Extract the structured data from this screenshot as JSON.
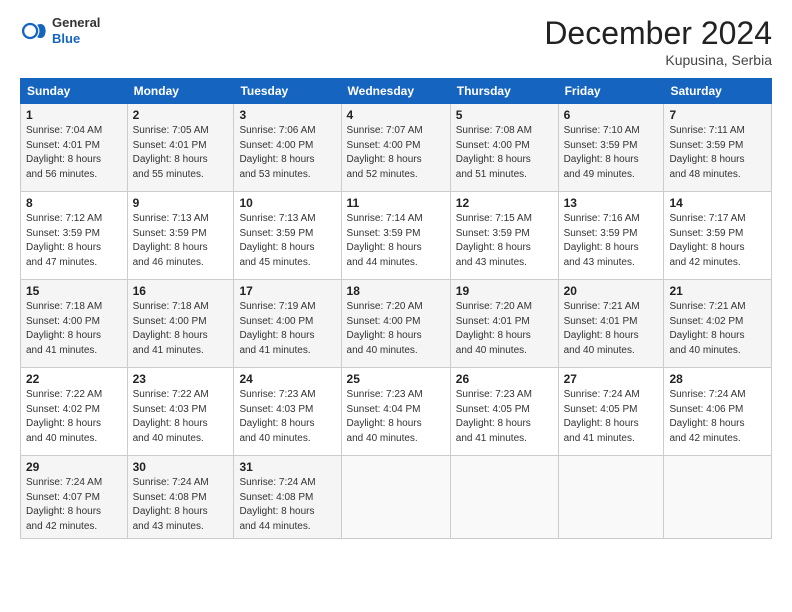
{
  "header": {
    "logo": {
      "general": "General",
      "blue": "Blue"
    },
    "title": "December 2024",
    "location": "Kupusina, Serbia"
  },
  "weekdays": [
    "Sunday",
    "Monday",
    "Tuesday",
    "Wednesday",
    "Thursday",
    "Friday",
    "Saturday"
  ],
  "weeks": [
    [
      {
        "day": "1",
        "sunrise": "7:04 AM",
        "sunset": "4:01 PM",
        "daylight": "8 hours and 56 minutes."
      },
      {
        "day": "2",
        "sunrise": "7:05 AM",
        "sunset": "4:01 PM",
        "daylight": "8 hours and 55 minutes."
      },
      {
        "day": "3",
        "sunrise": "7:06 AM",
        "sunset": "4:00 PM",
        "daylight": "8 hours and 53 minutes."
      },
      {
        "day": "4",
        "sunrise": "7:07 AM",
        "sunset": "4:00 PM",
        "daylight": "8 hours and 52 minutes."
      },
      {
        "day": "5",
        "sunrise": "7:08 AM",
        "sunset": "4:00 PM",
        "daylight": "8 hours and 51 minutes."
      },
      {
        "day": "6",
        "sunrise": "7:10 AM",
        "sunset": "3:59 PM",
        "daylight": "8 hours and 49 minutes."
      },
      {
        "day": "7",
        "sunrise": "7:11 AM",
        "sunset": "3:59 PM",
        "daylight": "8 hours and 48 minutes."
      }
    ],
    [
      {
        "day": "8",
        "sunrise": "7:12 AM",
        "sunset": "3:59 PM",
        "daylight": "8 hours and 47 minutes."
      },
      {
        "day": "9",
        "sunrise": "7:13 AM",
        "sunset": "3:59 PM",
        "daylight": "8 hours and 46 minutes."
      },
      {
        "day": "10",
        "sunrise": "7:13 AM",
        "sunset": "3:59 PM",
        "daylight": "8 hours and 45 minutes."
      },
      {
        "day": "11",
        "sunrise": "7:14 AM",
        "sunset": "3:59 PM",
        "daylight": "8 hours and 44 minutes."
      },
      {
        "day": "12",
        "sunrise": "7:15 AM",
        "sunset": "3:59 PM",
        "daylight": "8 hours and 43 minutes."
      },
      {
        "day": "13",
        "sunrise": "7:16 AM",
        "sunset": "3:59 PM",
        "daylight": "8 hours and 43 minutes."
      },
      {
        "day": "14",
        "sunrise": "7:17 AM",
        "sunset": "3:59 PM",
        "daylight": "8 hours and 42 minutes."
      }
    ],
    [
      {
        "day": "15",
        "sunrise": "7:18 AM",
        "sunset": "4:00 PM",
        "daylight": "8 hours and 41 minutes."
      },
      {
        "day": "16",
        "sunrise": "7:18 AM",
        "sunset": "4:00 PM",
        "daylight": "8 hours and 41 minutes."
      },
      {
        "day": "17",
        "sunrise": "7:19 AM",
        "sunset": "4:00 PM",
        "daylight": "8 hours and 41 minutes."
      },
      {
        "day": "18",
        "sunrise": "7:20 AM",
        "sunset": "4:00 PM",
        "daylight": "8 hours and 40 minutes."
      },
      {
        "day": "19",
        "sunrise": "7:20 AM",
        "sunset": "4:01 PM",
        "daylight": "8 hours and 40 minutes."
      },
      {
        "day": "20",
        "sunrise": "7:21 AM",
        "sunset": "4:01 PM",
        "daylight": "8 hours and 40 minutes."
      },
      {
        "day": "21",
        "sunrise": "7:21 AM",
        "sunset": "4:02 PM",
        "daylight": "8 hours and 40 minutes."
      }
    ],
    [
      {
        "day": "22",
        "sunrise": "7:22 AM",
        "sunset": "4:02 PM",
        "daylight": "8 hours and 40 minutes."
      },
      {
        "day": "23",
        "sunrise": "7:22 AM",
        "sunset": "4:03 PM",
        "daylight": "8 hours and 40 minutes."
      },
      {
        "day": "24",
        "sunrise": "7:23 AM",
        "sunset": "4:03 PM",
        "daylight": "8 hours and 40 minutes."
      },
      {
        "day": "25",
        "sunrise": "7:23 AM",
        "sunset": "4:04 PM",
        "daylight": "8 hours and 40 minutes."
      },
      {
        "day": "26",
        "sunrise": "7:23 AM",
        "sunset": "4:05 PM",
        "daylight": "8 hours and 41 minutes."
      },
      {
        "day": "27",
        "sunrise": "7:24 AM",
        "sunset": "4:05 PM",
        "daylight": "8 hours and 41 minutes."
      },
      {
        "day": "28",
        "sunrise": "7:24 AM",
        "sunset": "4:06 PM",
        "daylight": "8 hours and 42 minutes."
      }
    ],
    [
      {
        "day": "29",
        "sunrise": "7:24 AM",
        "sunset": "4:07 PM",
        "daylight": "8 hours and 42 minutes."
      },
      {
        "day": "30",
        "sunrise": "7:24 AM",
        "sunset": "4:08 PM",
        "daylight": "8 hours and 43 minutes."
      },
      {
        "day": "31",
        "sunrise": "7:24 AM",
        "sunset": "4:08 PM",
        "daylight": "8 hours and 44 minutes."
      },
      null,
      null,
      null,
      null
    ]
  ],
  "colors": {
    "header_bg": "#1565c0",
    "header_text": "#ffffff",
    "row_odd": "#f5f5f5",
    "row_even": "#ffffff"
  }
}
